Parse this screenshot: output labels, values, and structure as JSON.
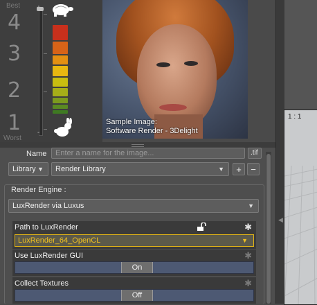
{
  "quality": {
    "best_label": "Best",
    "worst_label": "Worst",
    "levels": [
      "4",
      "3",
      "2",
      "1"
    ],
    "slider_level_fraction": 0.0,
    "bar_colors": [
      "#c8301c",
      "#d66318",
      "#e39012",
      "#e8b810",
      "#c8be10",
      "#a6ae18",
      "#7c9a1e",
      "#5a8a22",
      "#3f7a22"
    ],
    "slow_icon": "turtle-icon",
    "fast_icon": "rabbit-icon"
  },
  "preview": {
    "caption_line1": "Sample Image:",
    "caption_line2": "Software Render - 3Delight"
  },
  "viewport": {
    "label": "1 : 1"
  },
  "save": {
    "name_label": "Name",
    "name_placeholder": "Enter a name for the image...",
    "ext_value": ".tif",
    "location_value": "Library",
    "library_value": "Render Library",
    "add_symbol": "+",
    "remove_symbol": "−"
  },
  "engine": {
    "group_label": "Render Engine :",
    "selected": "LuxRender via Luxus"
  },
  "properties": [
    {
      "title": "Path to LuxRender",
      "type": "dropdown",
      "value": "LuxRender_64_OpenCL"
    },
    {
      "title": "Use LuxRender GUI",
      "type": "toggle",
      "value": "On"
    },
    {
      "title": "Collect Textures",
      "type": "toggle",
      "value": "Off"
    }
  ],
  "colors": {
    "accent_highlight": "#e2b416",
    "toggle_track": "#4d5973",
    "panel_bg": "#4e4e4e"
  }
}
